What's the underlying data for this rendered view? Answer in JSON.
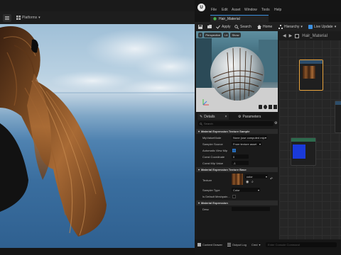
{
  "viewport": {
    "toolbar": {
      "platforms_label": "Platforms"
    }
  },
  "editor": {
    "menu": [
      "File",
      "Edit",
      "Asset",
      "Window",
      "Tools",
      "Help"
    ],
    "tab": {
      "title": "Hair_Material"
    },
    "toolbar": {
      "apply": "Apply",
      "search": "Search",
      "home": "Home",
      "hierarchy": "Hierarchy",
      "live_update": "Live Update"
    },
    "preview": {
      "mode": "Perspective",
      "lit": "Lit",
      "show": "Show"
    },
    "graph": {
      "breadcrumb": "Hair_Material"
    },
    "details": {
      "tab_details": "Details",
      "tab_parameters": "Parameters",
      "search_placeholder": "Search",
      "sections": {
        "texture_sample": "Material Expression Texture Sample",
        "texture_base": "Material Expression Texture Base",
        "expression": "Material Expression"
      },
      "fields": {
        "mip_value_mode": {
          "label": "MipValueMode",
          "value": "None (use computed mip"
        },
        "sampler_source": {
          "label": "Sampler Source",
          "value": "From texture asset"
        },
        "automatic_view_mip": {
          "label": "Automatic View Mip",
          "checked": true
        },
        "const_coordinate": {
          "label": "Const Coordinate",
          "value": "0"
        },
        "const_mip_value": {
          "label": "Const Mip Value",
          "value": "-1"
        },
        "texture": {
          "label": "Texture",
          "value": "color"
        },
        "sampler_type": {
          "label": "Sampler Type",
          "value": "Color"
        },
        "is_default_meshpaint": {
          "label": "Is Default Meshpain...",
          "checked": false
        },
        "desc": {
          "label": "Desc",
          "value": ""
        }
      }
    },
    "bottom": {
      "content_drawer": "Content Drawer",
      "output_log": "Output Log",
      "cmd": "Cmd",
      "console_placeholder": "Enter Console Command"
    }
  },
  "colors": {
    "accent": "#3c8fdf",
    "node_selected": "#e8a23c",
    "hair_brown": "#7a4a22"
  }
}
